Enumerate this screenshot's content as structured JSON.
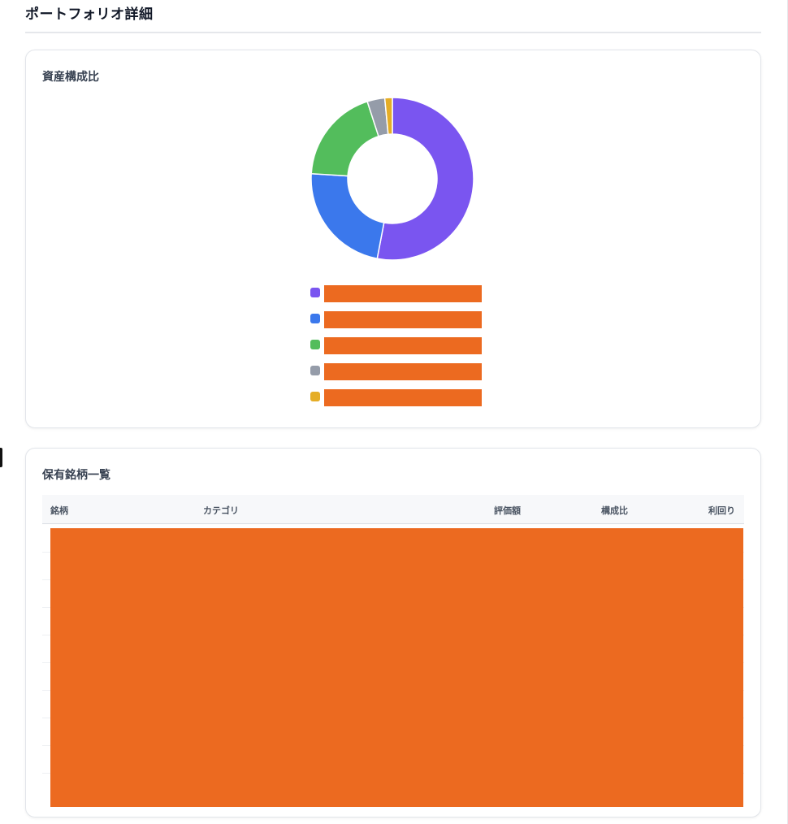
{
  "page": {
    "title": "ポートフォリオ詳細"
  },
  "allocation": {
    "title": "資産構成比",
    "chart_data": {
      "type": "pie",
      "style": "donut",
      "values": [
        53,
        23,
        19,
        3.5,
        1.5
      ],
      "colors": [
        "#7a55f0",
        "#3b78ec",
        "#53bd5c",
        "#959ca9",
        "#e5ad26"
      ]
    },
    "legend": [
      {
        "color": "#7a55f0",
        "label": ""
      },
      {
        "color": "#3b78ec",
        "label": ""
      },
      {
        "color": "#53bd5c",
        "label": ""
      },
      {
        "color": "#959ca9",
        "label": ""
      },
      {
        "color": "#e5ad26",
        "label": ""
      }
    ]
  },
  "holdings": {
    "title": "保有銘柄一覧",
    "columns": [
      "銘柄",
      "カテゴリ",
      "評価額",
      "構成比",
      "利回り"
    ],
    "rows": []
  },
  "colors": {
    "redaction": "#ec6a20"
  }
}
